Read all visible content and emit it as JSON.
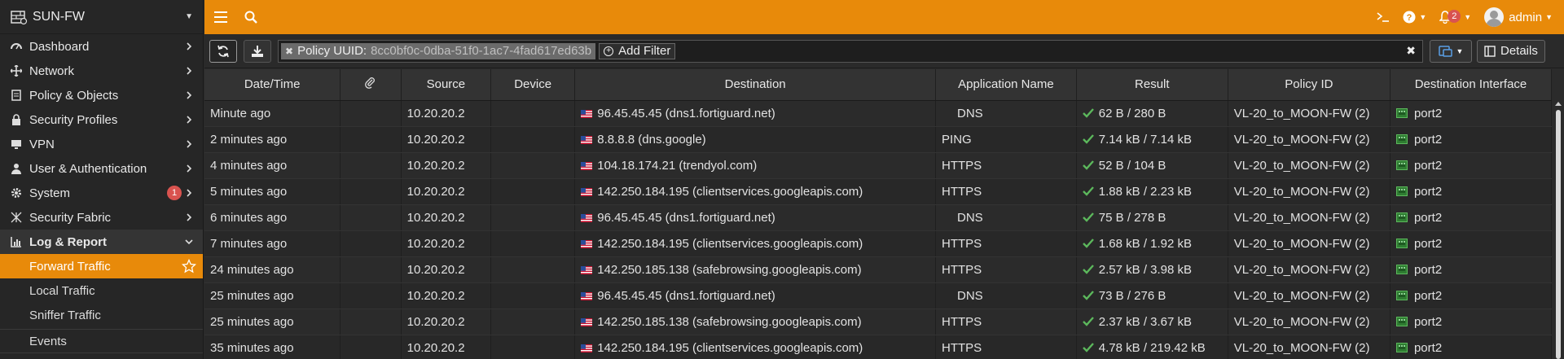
{
  "device": {
    "name": "SUN-FW"
  },
  "sidebar": {
    "items": [
      {
        "label": "Dashboard",
        "icon": "dashboard-icon"
      },
      {
        "label": "Network",
        "icon": "network-icon"
      },
      {
        "label": "Policy & Objects",
        "icon": "policy-icon"
      },
      {
        "label": "Security Profiles",
        "icon": "lock-icon"
      },
      {
        "label": "VPN",
        "icon": "monitor-icon"
      },
      {
        "label": "User & Authentication",
        "icon": "user-icon"
      },
      {
        "label": "System",
        "icon": "gear-icon",
        "badge": "1"
      },
      {
        "label": "Security Fabric",
        "icon": "fabric-icon"
      },
      {
        "label": "Log & Report",
        "icon": "chart-icon"
      }
    ],
    "log_subitems": [
      {
        "label": "Forward Traffic"
      },
      {
        "label": "Local Traffic"
      },
      {
        "label": "Sniffer Traffic"
      },
      {
        "label": "Events"
      }
    ]
  },
  "topbar": {
    "notifications_count": "2",
    "user": "admin"
  },
  "toolbar": {
    "filter_key": "Policy UUID:",
    "filter_value": "8cc0bf0c-0dba-51f0-1ac7-4fad617ed63b",
    "add_filter_label": "Add Filter",
    "details_label": "Details"
  },
  "table": {
    "columns": [
      "Date/Time",
      "",
      "Source",
      "Device",
      "Destination",
      "Application Name",
      "Result",
      "Policy ID",
      "Destination Interface"
    ],
    "rows": [
      {
        "time": "Minute ago",
        "source": "10.20.20.2",
        "destination": "96.45.45.45 (dns1.fortiguard.net)",
        "app": "DNS",
        "result": "62 B / 280 B",
        "policy": "VL-20_to_MOON-FW (2)",
        "iface": "port2"
      },
      {
        "time": "2 minutes ago",
        "source": "10.20.20.2",
        "destination": "8.8.8.8 (dns.google)",
        "app": "PING",
        "result": "7.14 kB / 7.14 kB",
        "policy": "VL-20_to_MOON-FW (2)",
        "iface": "port2"
      },
      {
        "time": "4 minutes ago",
        "source": "10.20.20.2",
        "destination": "104.18.174.21 (trendyol.com)",
        "app": "HTTPS",
        "result": "52 B / 104 B",
        "policy": "VL-20_to_MOON-FW (2)",
        "iface": "port2"
      },
      {
        "time": "5 minutes ago",
        "source": "10.20.20.2",
        "destination": "142.250.184.195 (clientservices.googleapis.com)",
        "app": "HTTPS",
        "result": "1.88 kB / 2.23 kB",
        "policy": "VL-20_to_MOON-FW (2)",
        "iface": "port2"
      },
      {
        "time": "6 minutes ago",
        "source": "10.20.20.2",
        "destination": "96.45.45.45 (dns1.fortiguard.net)",
        "app": "DNS",
        "result": "75 B / 278 B",
        "policy": "VL-20_to_MOON-FW (2)",
        "iface": "port2"
      },
      {
        "time": "7 minutes ago",
        "source": "10.20.20.2",
        "destination": "142.250.184.195 (clientservices.googleapis.com)",
        "app": "HTTPS",
        "result": "1.68 kB / 1.92 kB",
        "policy": "VL-20_to_MOON-FW (2)",
        "iface": "port2"
      },
      {
        "time": "24 minutes ago",
        "source": "10.20.20.2",
        "destination": "142.250.185.138 (safebrowsing.googleapis.com)",
        "app": "HTTPS",
        "result": "2.57 kB / 3.98 kB",
        "policy": "VL-20_to_MOON-FW (2)",
        "iface": "port2"
      },
      {
        "time": "25 minutes ago",
        "source": "10.20.20.2",
        "destination": "96.45.45.45 (dns1.fortiguard.net)",
        "app": "DNS",
        "result": "73 B / 276 B",
        "policy": "VL-20_to_MOON-FW (2)",
        "iface": "port2"
      },
      {
        "time": "25 minutes ago",
        "source": "10.20.20.2",
        "destination": "142.250.185.138 (safebrowsing.googleapis.com)",
        "app": "HTTPS",
        "result": "2.37 kB / 3.67 kB",
        "policy": "VL-20_to_MOON-FW (2)",
        "iface": "port2"
      },
      {
        "time": "35 minutes ago",
        "source": "10.20.20.2",
        "destination": "142.250.184.195 (clientservices.googleapis.com)",
        "app": "HTTPS",
        "result": "4.78 kB / 219.42 kB",
        "policy": "VL-20_to_MOON-FW (2)",
        "iface": "port2"
      }
    ]
  },
  "colors": {
    "accent": "#e88a0a",
    "success": "#5cb85c",
    "badge": "#d9534f"
  }
}
